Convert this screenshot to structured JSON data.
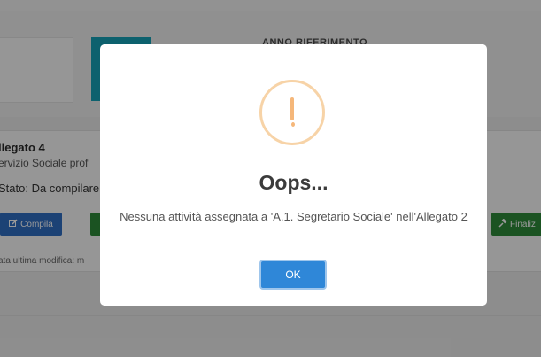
{
  "background": {
    "anno_label": "ANNO RIFERIMENTO",
    "card": {
      "title": "llegato 4",
      "subtitle": "ervizio Sociale prof",
      "stato": "Stato: Da compilare",
      "compila_label": "Compila",
      "finalizza_label": "Finaliz",
      "meta": "ata ultima modifica: m"
    }
  },
  "dialog": {
    "icon": "warning-exclamation-icon",
    "title": "Oops...",
    "message": "Nessuna attività assegnata a 'A.1. Segretario Sociale' nell'Allegato 2",
    "ok_label": "OK"
  },
  "colors": {
    "teal": "#17a2b8",
    "primary": "#2f87d8",
    "success": "#2e8b3a",
    "warning": "#f5b77a"
  }
}
